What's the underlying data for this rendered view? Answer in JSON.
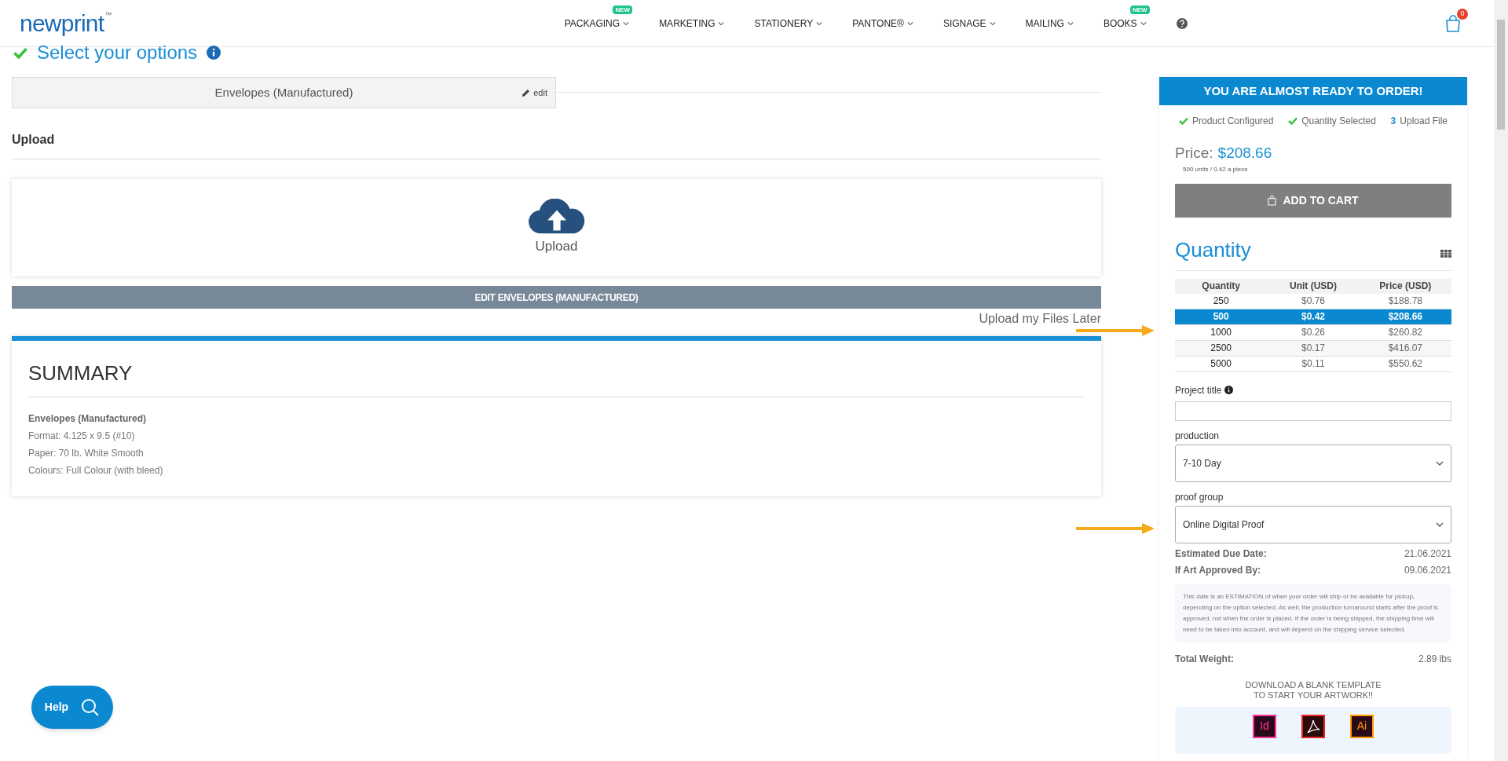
{
  "header": {
    "logo": "newprint",
    "logo_mark": "™",
    "nav": [
      {
        "label": "PACKAGING",
        "badge": "NEW"
      },
      {
        "label": "MARKETING"
      },
      {
        "label": "STATIONERY"
      },
      {
        "label": "PANTONE®"
      },
      {
        "label": "SIGNAGE"
      },
      {
        "label": "MAILING"
      },
      {
        "label": "BOOKS",
        "badge": "NEW"
      }
    ],
    "cart_count": "0"
  },
  "options": {
    "title": "Select your options",
    "product": "Envelopes (Manufactured)",
    "edit": "edit"
  },
  "upload": {
    "heading": "Upload",
    "drop_label": "Upload",
    "edit_button": "EDIT ENVELOPES (MANUFACTURED)",
    "later_link": "Upload my Files Later"
  },
  "summary": {
    "title": "SUMMARY",
    "product": "Envelopes (Manufactured)",
    "lines": [
      "Format: 4.125 x 9.5 (#10)",
      "Paper: 70 lb. White Smooth",
      "Colours: Full Colour (with bleed)"
    ]
  },
  "order_panel": {
    "banner": "YOU ARE ALMOST READY TO ORDER!",
    "steps": [
      {
        "kind": "done",
        "label": "Product Configured"
      },
      {
        "kind": "done",
        "label": "Quantity Selected"
      },
      {
        "kind": "pending",
        "number": "3",
        "label": "Upload File"
      }
    ],
    "price_label": "Price:",
    "price": "$208.66",
    "price_note": "500 units / 0.42 a piece",
    "add_to_cart": "ADD TO CART",
    "quantity_title": "Quantity",
    "table": {
      "columns": [
        "Quantity",
        "Unit (USD)",
        "Price (USD)"
      ],
      "rows": [
        {
          "cells": [
            "250",
            "$0.76",
            "$188.78"
          ],
          "selected": false
        },
        {
          "cells": [
            "500",
            "$0.42",
            "$208.66"
          ],
          "selected": true
        },
        {
          "cells": [
            "1000",
            "$0.26",
            "$260.82"
          ],
          "selected": false
        },
        {
          "cells": [
            "2500",
            "$0.17",
            "$416.07"
          ],
          "selected": false
        },
        {
          "cells": [
            "5000",
            "$0.11",
            "$550.62"
          ],
          "selected": false
        }
      ]
    },
    "project_title_label": "Project title",
    "production": {
      "label": "production",
      "value": "7-10 Day"
    },
    "proof_group": {
      "label": "proof group",
      "value": "Online Digital Proof"
    },
    "dates": [
      {
        "label": "Estimated Due Date:",
        "value": "21.06.2021"
      },
      {
        "label": "If Art Approved By:",
        "value": "09.06.2021"
      }
    ],
    "note": "This date is an ESTIMATION of when your order will ship or be available for pickup, depending on the option selected. As well, the production turnaround starts after the proof is approved, not when the order is placed. If the order is being shipped, the shipping time will need to be taken into account, and will depend on the shipping service selected.",
    "weight_label": "Total Weight:",
    "weight": "2.89 lbs",
    "template_heading": [
      "DOWNLOAD A BLANK TEMPLATE",
      "TO START YOUR ARTWORK!!"
    ],
    "templates": [
      {
        "kind": "letters",
        "label": "Id",
        "color": "#ff3399"
      },
      {
        "kind": "pdf",
        "color": "#e8251f"
      },
      {
        "kind": "letters",
        "label": "Ai",
        "color": "#ff9a00"
      }
    ]
  },
  "help": "Help"
}
